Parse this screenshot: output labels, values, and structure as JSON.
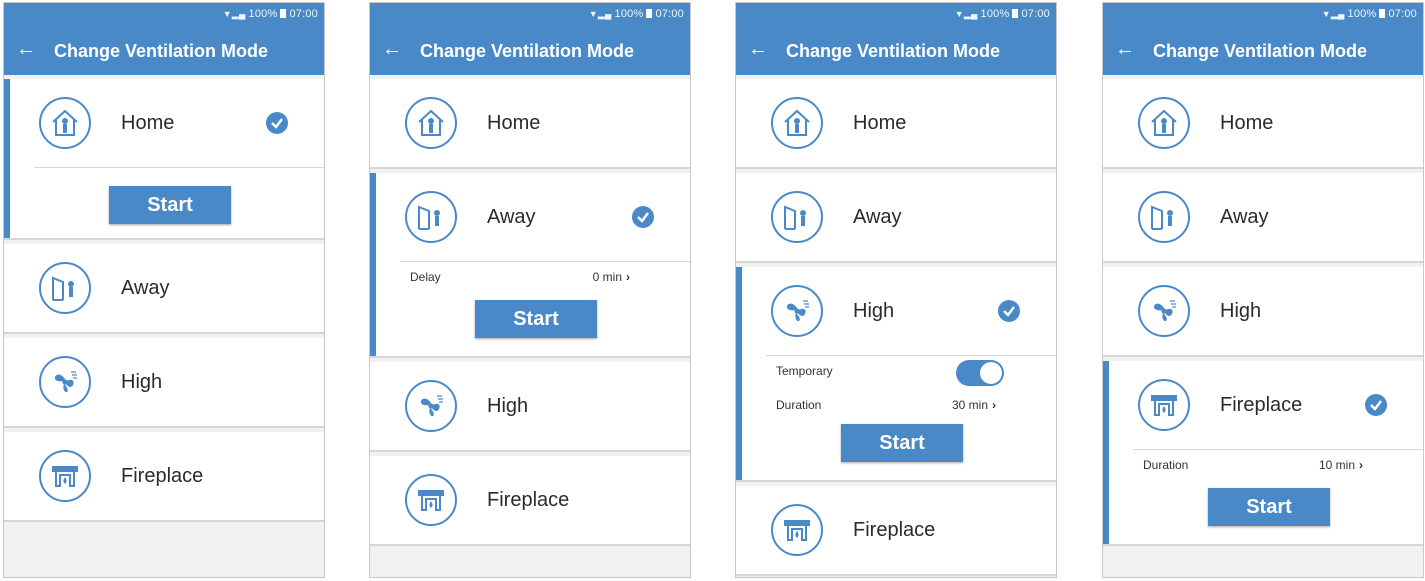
{
  "status_bar": {
    "battery": "100%",
    "time": "07:00"
  },
  "header": {
    "title": "Change Ventilation Mode"
  },
  "modes": {
    "home": "Home",
    "away": "Away",
    "high": "High",
    "fireplace": "Fireplace"
  },
  "start_label": "Start",
  "options": {
    "delay_label": "Delay",
    "delay_value": "0 min",
    "temporary_label": "Temporary",
    "duration_label": "Duration",
    "high_duration_value": "30 min",
    "fireplace_duration_value": "10 min"
  },
  "state": {
    "temporary_enabled": true
  },
  "accent_color": "#4a89c8",
  "icons": {
    "home": "home-person-icon",
    "away": "door-person-icon",
    "high": "fan-icon",
    "fireplace": "fireplace-icon",
    "check": "checkmark-icon"
  }
}
